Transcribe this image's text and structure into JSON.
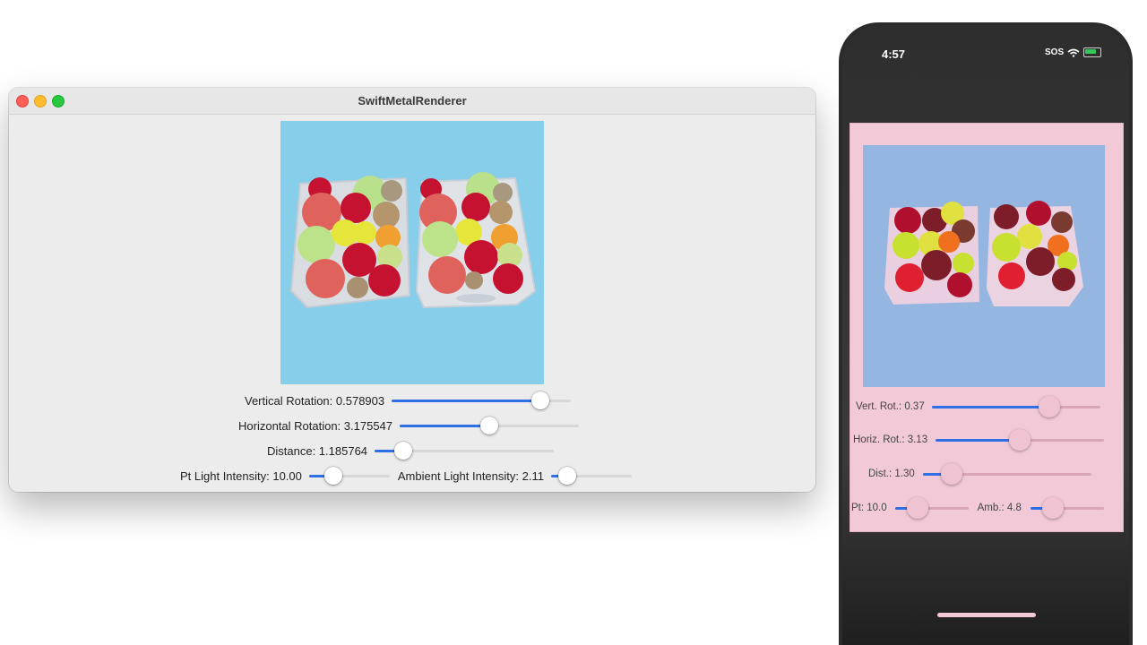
{
  "window": {
    "title": "SwiftMetalRenderer",
    "background_color": "#87ceeb"
  },
  "controls": {
    "vertical_rotation": {
      "label": "Vertical Rotation: 0.578903",
      "fraction": 0.83
    },
    "horizontal_rotation": {
      "label": "Horizontal Rotation: 3.175547",
      "fraction": 0.5
    },
    "distance": {
      "label": "Distance: 1.185764",
      "fraction": 0.16
    },
    "pt_light": {
      "label": "Pt Light Intensity: 10.00",
      "fraction": 0.3
    },
    "ambient_light": {
      "label": "Ambient Light Intensity: 2.11",
      "fraction": 0.2
    }
  },
  "phone": {
    "time": "4:57",
    "status": "SOS",
    "background_color": "#96b6e2",
    "panel_color": "#f2c9d6",
    "controls": {
      "vert_rot": {
        "label": "Vert. Rot.: 0.37",
        "fraction": 0.7
      },
      "horiz_rot": {
        "label": "Horiz. Rot.: 3.13",
        "fraction": 0.5
      },
      "dist": {
        "label": "Dist.: 1.30",
        "fraction": 0.17
      },
      "pt": {
        "label": "Pt: 10.0",
        "fraction": 0.31
      },
      "amb": {
        "label": "Amb.: 4.8",
        "fraction": 0.31
      }
    }
  },
  "scene": {
    "left_basket": "white-basket",
    "right_basket": "wicker-basket",
    "fruits": "apples, kiwis, oranges, pears"
  }
}
